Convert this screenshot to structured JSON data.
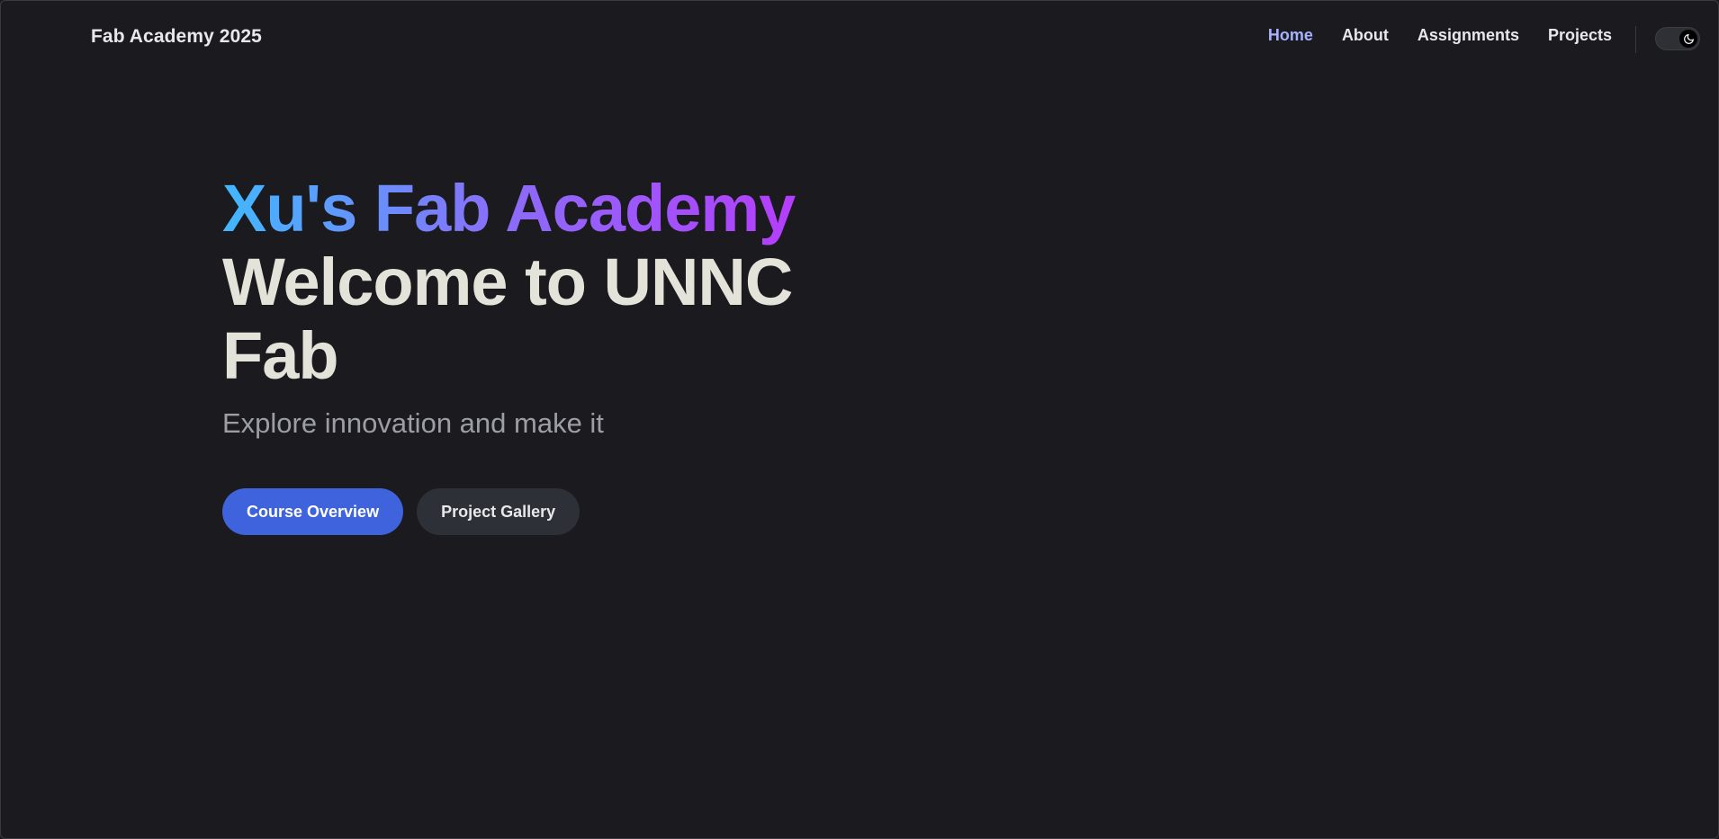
{
  "nav": {
    "site_title": "Fab Academy 2025",
    "links": [
      {
        "label": "Home",
        "active": true
      },
      {
        "label": "About",
        "active": false
      },
      {
        "label": "Assignments",
        "active": false
      },
      {
        "label": "Projects",
        "active": false
      }
    ],
    "theme_toggle_icon": "moon-icon"
  },
  "hero": {
    "name": "Xu's Fab Academy",
    "text": "Welcome to UNNC Fab",
    "tagline": "Explore innovation and make it",
    "actions": {
      "primary": "Course Overview",
      "secondary": "Project Gallery"
    }
  },
  "colors": {
    "background": "#1b1b1f",
    "nav_active": "#a8b1ff",
    "gradient_start": "#41b8ff",
    "gradient_end": "#bd34fe",
    "primary_button": "#3e63dd",
    "secondary_button": "#2e3038",
    "hero_text": "#e3e3da",
    "tagline": "#9d9da5"
  }
}
